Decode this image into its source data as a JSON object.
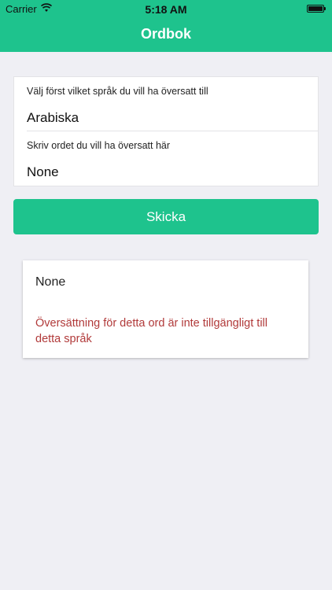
{
  "status_bar": {
    "carrier": "Carrier",
    "time": "5:18 AM",
    "icons": [
      "wifi-icon",
      "battery-icon"
    ]
  },
  "nav": {
    "title": "Ordbok"
  },
  "form": {
    "language_label": "Välj först vilket språk du vill ha översatt till",
    "language_value": "Arabiska",
    "word_label": "Skriv ordet du vill ha översatt här",
    "word_value": "None"
  },
  "send_button": {
    "label": "Skicka"
  },
  "result": {
    "word": "None",
    "error": "Översättning för detta ord är inte tillgängligt till detta språk"
  },
  "colors": {
    "accent": "#1ec38d",
    "background": "#efeff4",
    "error": "#b13a3a"
  }
}
